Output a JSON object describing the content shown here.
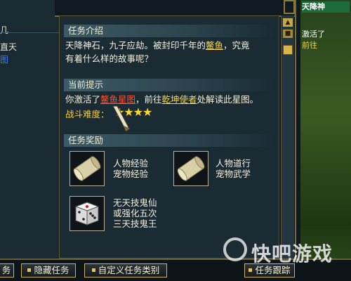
{
  "left_strip": {
    "lines": [
      "几",
      "直天",
      "图"
    ]
  },
  "quest": {
    "intro_header": "任务介绍",
    "intro_line1_a": "天降神石，九子应劫。被封印千年的",
    "intro_line1_b": "鳌鱼",
    "intro_line1_c": "，究竟",
    "intro_line2": "有着什么样的故事呢？",
    "hint_header": "当前提示",
    "hint_a": "你激活了",
    "hint_item": "鳌鱼星图",
    "hint_b": "，前往",
    "hint_npc": "乾坤使者",
    "hint_c": "处解读此星图。",
    "difficulty_label": "战斗难度：",
    "difficulty_stars": 4,
    "difficulty_glyph": "★★★★",
    "reward_header": "任务奖励",
    "rewards": [
      {
        "icon": "scroll-icon",
        "line1": "人物经验",
        "line2": "宠物经验"
      },
      {
        "icon": "scroll-icon",
        "line1": "人物道行",
        "line2": "宠物武学"
      },
      {
        "icon": "dice-icon",
        "line1": "无天技鬼仙",
        "line2": "或强化五次",
        "line3": "三天技鬼王"
      }
    ]
  },
  "world": {
    "title": "天降神",
    "line1": "激活了",
    "line2": "前往"
  },
  "bottom_bar": {
    "btn_partial": "务",
    "btn_hide": "隐藏任务",
    "btn_custom": "自定义任务类别",
    "btn_track": "任务跟踪"
  },
  "watermark": {
    "text": "快吧游戏"
  },
  "colors": {
    "accent_gold": "#c8b066",
    "highlight_red": "#ff4f2e",
    "highlight_yellow": "#f7d44e"
  }
}
